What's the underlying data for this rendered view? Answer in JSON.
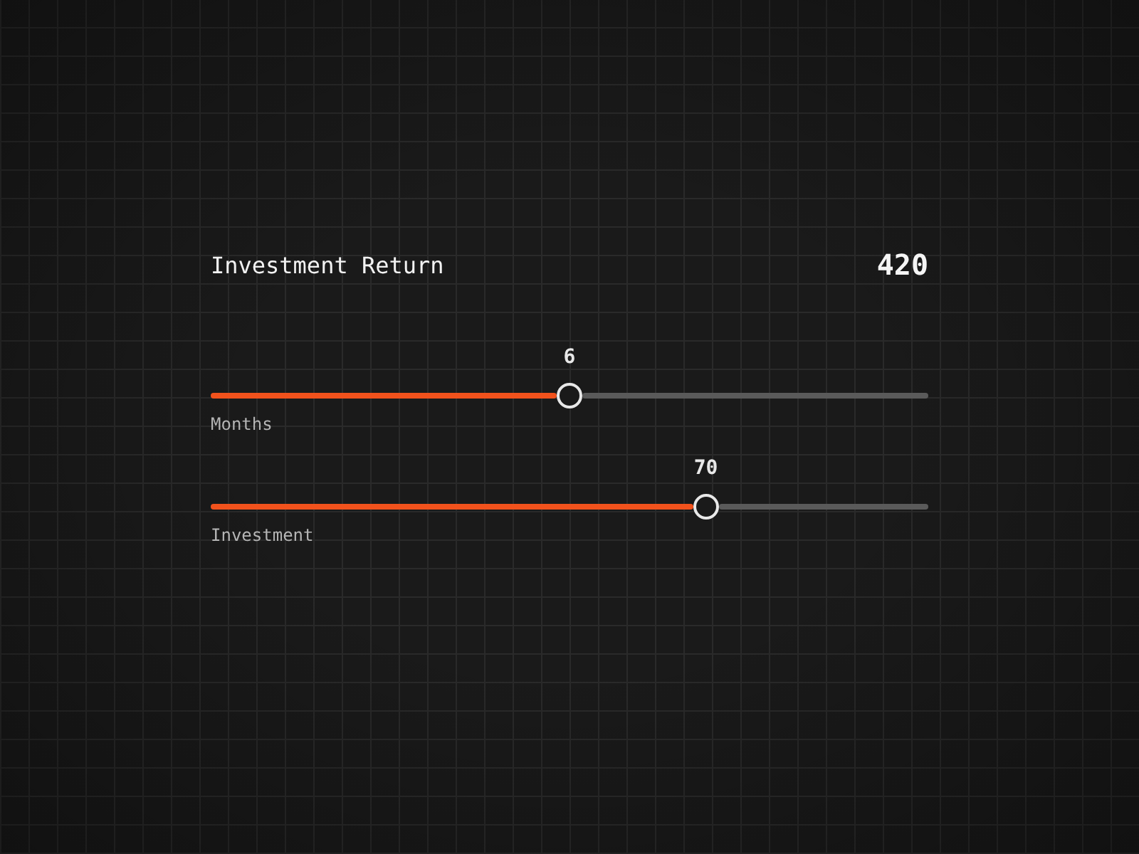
{
  "title": "Investment Return",
  "total": "420",
  "sliders": [
    {
      "label": "Months",
      "reading": "6",
      "level": 0.5
    },
    {
      "label": "Investment",
      "reading": "70",
      "level": 0.69
    }
  ]
}
